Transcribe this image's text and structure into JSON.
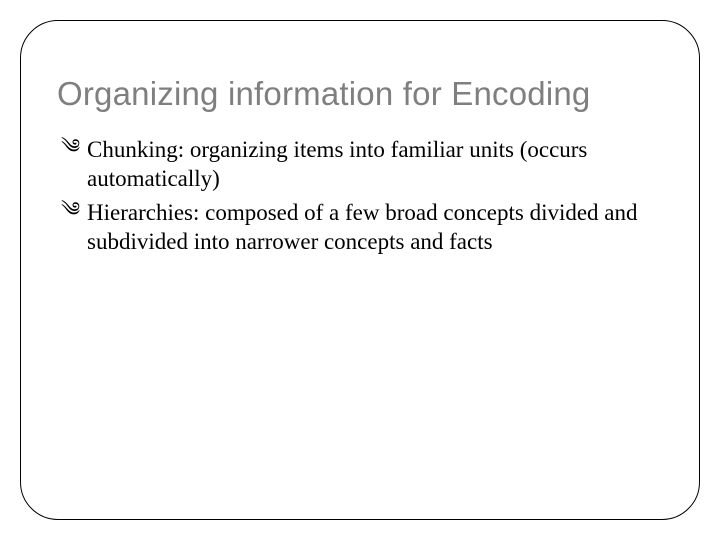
{
  "slide": {
    "title": "Organizing information for Encoding",
    "bullets": [
      {
        "text": "Chunking: organizing items into familiar units (occurs automatically)"
      },
      {
        "text": "Hierarchies: composed of a few broad concepts divided and subdivided into narrower concepts and facts"
      }
    ],
    "bullet_glyph": "༄",
    "page_number": ""
  }
}
